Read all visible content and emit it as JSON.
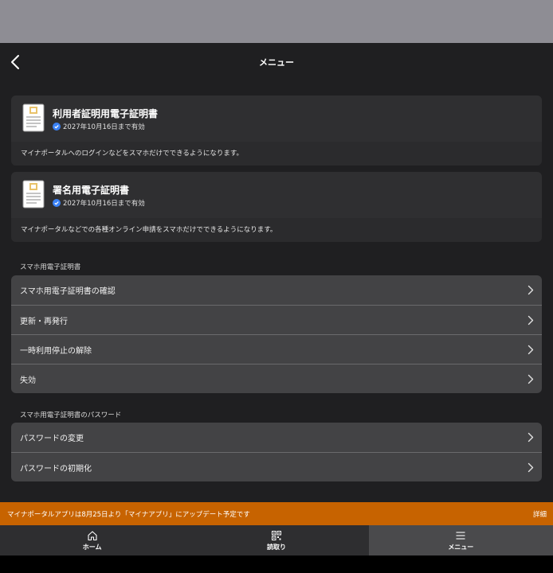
{
  "header": {
    "title": "メニュー"
  },
  "certificates": [
    {
      "title": "利用者証明用電子証明書",
      "validity": "2027年10月16日まで有効",
      "description": "マイナポータルへのログインなどをスマホだけでできるようになります。"
    },
    {
      "title": "署名用電子証明書",
      "validity": "2027年10月16日まで有効",
      "description": "マイナポータルなどでの各種オンライン申請をスマホだけでできるようになります。"
    }
  ],
  "sections": {
    "certificate": {
      "label": "スマホ用電子証明書",
      "items": [
        "スマホ用電子証明書の確認",
        "更新・再発行",
        "一時利用停止の解除",
        "失効"
      ]
    },
    "password": {
      "label": "スマホ用電子証明書のパスワード",
      "items": [
        "パスワードの変更",
        "パスワードの初期化"
      ]
    }
  },
  "banner": {
    "text": "マイナポータルアプリは8月25日より「マイナアプリ」にアップデート予定です",
    "detail_label": "詳細"
  },
  "tabs": [
    {
      "label": "ホーム",
      "icon": "home-icon"
    },
    {
      "label": "読取り",
      "icon": "qr-icon"
    },
    {
      "label": "メニュー",
      "icon": "menu-icon",
      "active": true
    }
  ],
  "colors": {
    "background": "#1f1f21",
    "card": "#2b2b2d",
    "menu_group": "#434345",
    "banner": "#c76300",
    "check_badge": "#3b82f6",
    "status_area": "#8e8d94"
  }
}
